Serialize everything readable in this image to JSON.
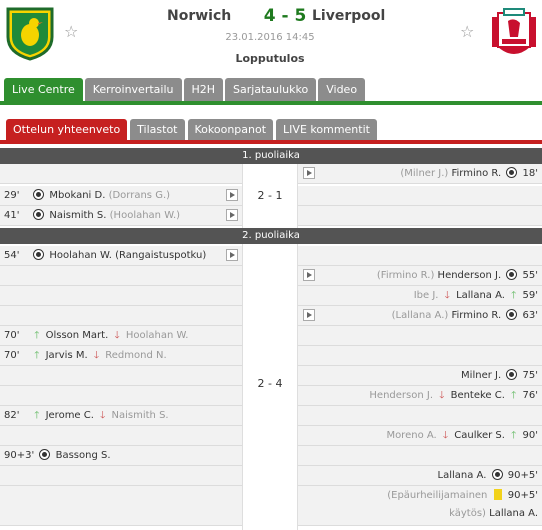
{
  "match": {
    "home_team": "Norwich",
    "away_team": "Liverpool",
    "score": "4 - 5",
    "date": "23.01.2016 14:45",
    "status": "Lopputulos"
  },
  "main_tabs": [
    "Live Centre",
    "Kerroinvertailu",
    "H2H",
    "Sarjataulukko",
    "Video"
  ],
  "sub_tabs": [
    "Ottelun yhteenveto",
    "Tilastot",
    "Kokoonpanot",
    "LIVE kommentit"
  ],
  "periods": {
    "first": {
      "label": "1. puoliaika",
      "score": "2 - 1"
    },
    "second": {
      "label": "2. puoliaika",
      "score": "2 - 4"
    }
  },
  "events": {
    "e1": {
      "min": "18'",
      "player": "Firmino R.",
      "assist": "(Milner J.)"
    },
    "e2": {
      "min": "29'",
      "player": "Mbokani D.",
      "assist": "(Dorrans G.)"
    },
    "e3": {
      "min": "41'",
      "player": "Naismith S.",
      "assist": "(Hoolahan W.)"
    },
    "e4": {
      "min": "54'",
      "player": "Hoolahan W.",
      "assist": "(Rangaistuspotku)"
    },
    "e5": {
      "min": "55'",
      "player": "Henderson J.",
      "assist": "(Firmino R.)"
    },
    "e6": {
      "min": "59'",
      "in": "Lallana A.",
      "out": "Ibe J."
    },
    "e7": {
      "min": "63'",
      "player": "Firmino R.",
      "assist": "(Lallana A.)"
    },
    "e8": {
      "min": "70'",
      "in": "Olsson Mart.",
      "out": "Hoolahan W."
    },
    "e9": {
      "min": "70'",
      "in": "Jarvis M.",
      "out": "Redmond N."
    },
    "e10": {
      "min": "75'",
      "player": "Milner J."
    },
    "e11": {
      "min": "76'",
      "player": "Benteke C.",
      "assist": "Henderson J."
    },
    "e12": {
      "min": "82'",
      "in": "Jerome C.",
      "out": "Naismith S."
    },
    "e13": {
      "min": "90'",
      "in": "Caulker S.",
      "out": "Moreno A."
    },
    "e14": {
      "min": "90+3'",
      "player": "Bassong S."
    },
    "e15": {
      "min": "90+5'",
      "player": "Lallana A."
    },
    "e16": {
      "min": "90+5'",
      "note1": "(Epäurheilijamainen",
      "note2": "käytös)",
      "player": "Lallana A."
    }
  }
}
